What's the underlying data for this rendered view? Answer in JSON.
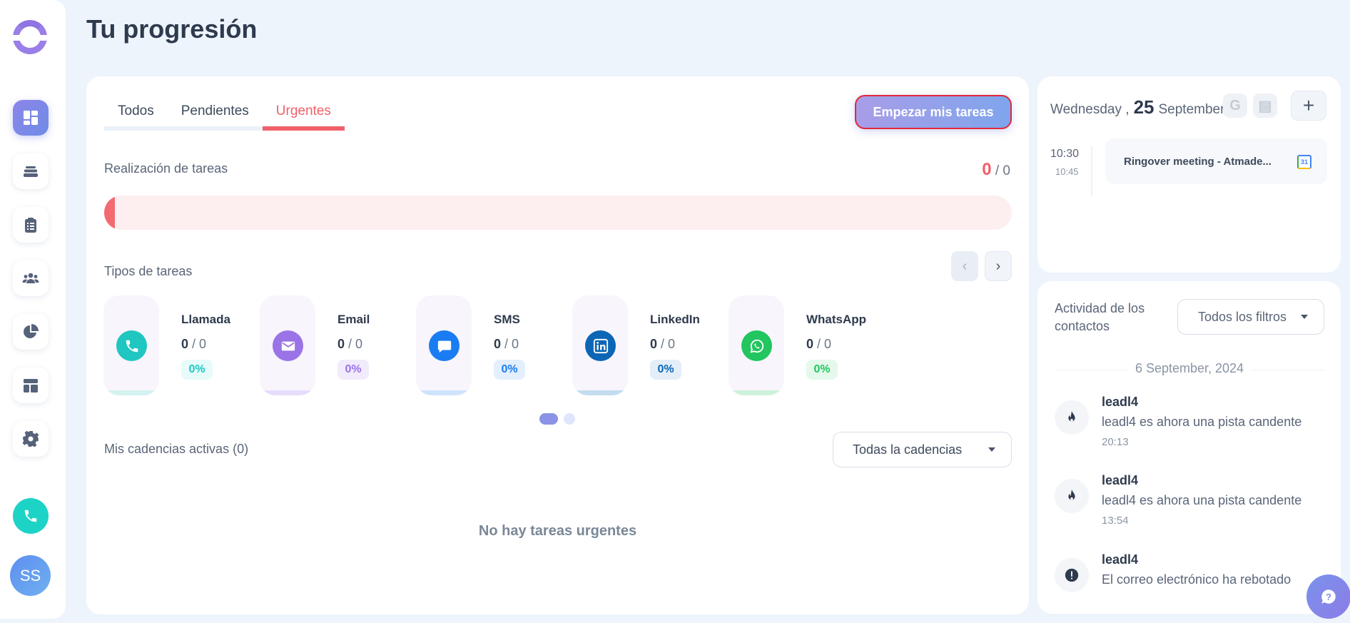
{
  "page": {
    "title": "Tu progresión"
  },
  "tabs": [
    {
      "label": "Todos"
    },
    {
      "label": "Pendientes"
    },
    {
      "label": "Urgentes",
      "active": true
    }
  ],
  "actions": {
    "start_tasks": "Empezar mis tareas"
  },
  "completion": {
    "label": "Realización de tareas",
    "done": "0",
    "total": "/ 0",
    "progress_fraction": 0.0
  },
  "task_types": {
    "label": "Tipos de tareas",
    "items": [
      {
        "name": "Llamada",
        "done": "0",
        "total": "/ 0",
        "pct": "0%",
        "icon": "phone-icon",
        "accent": "#20c6c0",
        "light": "#d3f2f0",
        "pct_bg": "#e6fbfa"
      },
      {
        "name": "Email",
        "done": "0",
        "total": "/ 0",
        "pct": "0%",
        "icon": "envelope-icon",
        "accent": "#9a73e6",
        "light": "#e7dcfa",
        "pct_bg": "#f1ebfc"
      },
      {
        "name": "SMS",
        "done": "0",
        "total": "/ 0",
        "pct": "0%",
        "icon": "chat-bubble-icon",
        "accent": "#1a7cf2",
        "light": "#cfe3fb",
        "pct_bg": "#e4effd"
      },
      {
        "name": "LinkedIn",
        "done": "0",
        "total": "/ 0",
        "pct": "0%",
        "icon": "linkedin-icon",
        "accent": "#0c66b5",
        "light": "#c3dcef",
        "pct_bg": "#e3eef8"
      },
      {
        "name": "WhatsApp",
        "done": "0",
        "total": "/ 0",
        "pct": "0%",
        "icon": "whatsapp-icon",
        "accent": "#22c55e",
        "light": "#cdf2db",
        "pct_bg": "#e4f9ec"
      }
    ]
  },
  "cadences": {
    "label": "Mis cadencias activas (0)",
    "select_value": "Todas la cadencias",
    "empty": "No hay tareas urgentes"
  },
  "calendar": {
    "weekday": "Wednesday ,",
    "day": "25",
    "month": "September",
    "event": {
      "start": "10:30",
      "end": "10:45",
      "title": "Ringover meeting - Atmade...",
      "badge": "31"
    }
  },
  "activity": {
    "title": "Actividad de los contactos",
    "filter": "Todos los filtros",
    "date": "6 September, 2024",
    "items": [
      {
        "name": "leadl4",
        "desc": "leadl4 es ahora una pista candente",
        "time": "20:13",
        "icon": "flame-icon"
      },
      {
        "name": "leadl4",
        "desc": "leadl4 es ahora una pista candente",
        "time": "13:54",
        "icon": "flame-icon"
      },
      {
        "name": "leadl4",
        "desc": "El correo electrónico ha rebotado",
        "time": "",
        "icon": "alert-icon"
      }
    ]
  },
  "user": {
    "initials": "SS"
  }
}
